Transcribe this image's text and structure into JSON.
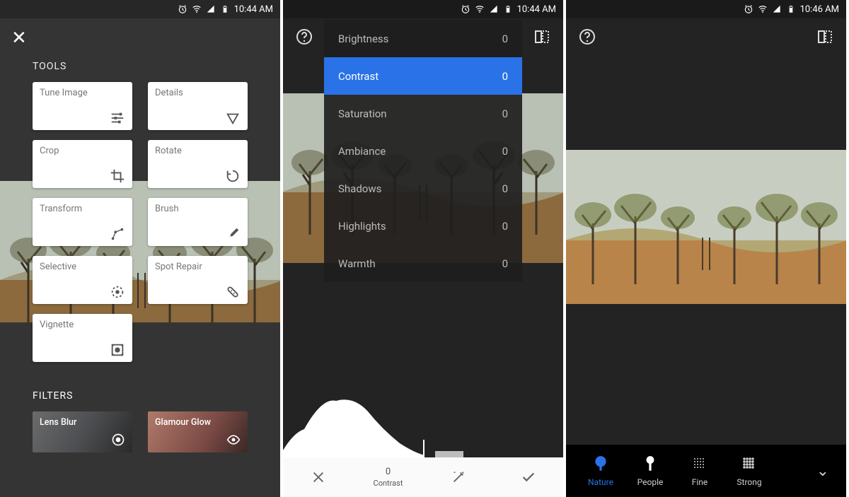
{
  "status": {
    "time_a": "10:44 AM",
    "time_b": "10:44 AM",
    "time_c": "10:46 AM"
  },
  "screen1": {
    "heading_tools": "TOOLS",
    "heading_filters": "FILTERS",
    "tools": [
      {
        "label": "Tune Image",
        "icon": "sliders"
      },
      {
        "label": "Details",
        "icon": "triangle-down"
      },
      {
        "label": "Crop",
        "icon": "crop"
      },
      {
        "label": "Rotate",
        "icon": "rotate"
      },
      {
        "label": "Transform",
        "icon": "transform"
      },
      {
        "label": "Brush",
        "icon": "brush"
      },
      {
        "label": "Selective",
        "icon": "selective"
      },
      {
        "label": "Spot Repair",
        "icon": "bandage"
      },
      {
        "label": "Vignette",
        "icon": "vignette"
      }
    ],
    "filters": [
      {
        "label": "Lens Blur",
        "icon": "aperture"
      },
      {
        "label": "Glamour Glow",
        "icon": "eye"
      }
    ]
  },
  "screen2": {
    "adjustments": [
      {
        "label": "Brightness",
        "value": "0",
        "selected": false
      },
      {
        "label": "Contrast",
        "value": "0",
        "selected": true
      },
      {
        "label": "Saturation",
        "value": "0",
        "selected": false
      },
      {
        "label": "Ambiance",
        "value": "0",
        "selected": false
      },
      {
        "label": "Shadows",
        "value": "0",
        "selected": false
      },
      {
        "label": "Highlights",
        "value": "0",
        "selected": false
      },
      {
        "label": "Warmth",
        "value": "0",
        "selected": false
      }
    ],
    "bottom": {
      "current_value": "0",
      "current_label": "Contrast"
    }
  },
  "screen3": {
    "presets": [
      {
        "label": "Nature",
        "active": true,
        "icon": "tree-filled"
      },
      {
        "label": "People",
        "active": false,
        "icon": "person"
      },
      {
        "label": "Fine",
        "active": false,
        "icon": "dots-fine"
      },
      {
        "label": "Strong",
        "active": false,
        "icon": "dots-strong"
      }
    ]
  }
}
